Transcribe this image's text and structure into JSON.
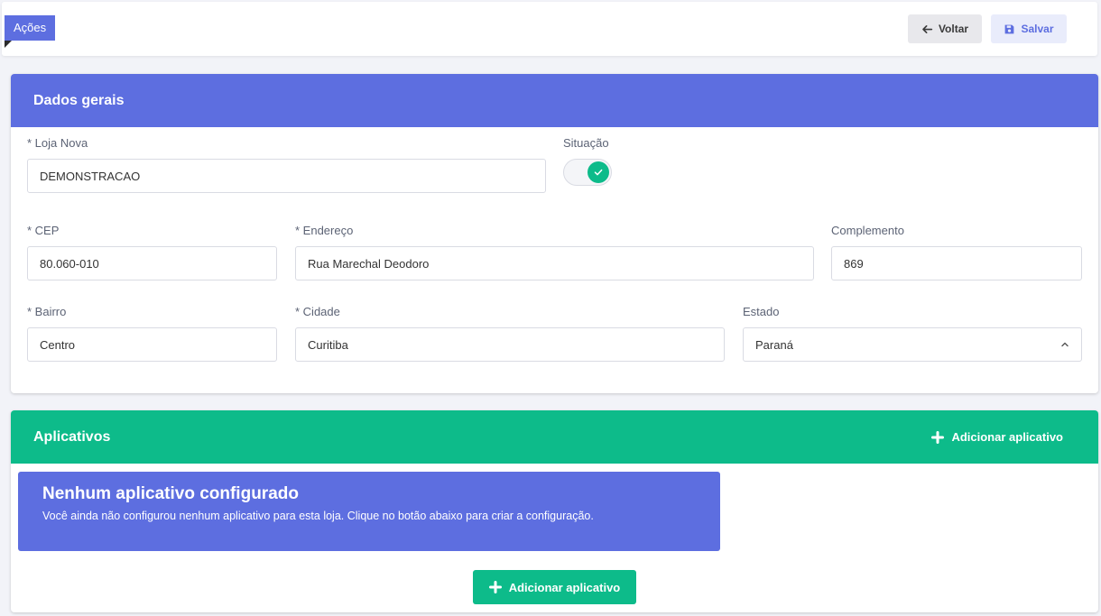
{
  "actions": {
    "ribbon_label": "Ações",
    "back_label": "Voltar",
    "save_label": "Salvar"
  },
  "general": {
    "title": "Dados gerais",
    "store": {
      "label": "* Loja Nova",
      "value": "DEMONSTRACAO"
    },
    "status": {
      "label": "Situação",
      "active": true
    },
    "cep": {
      "label": "* CEP",
      "value": "80.060-010"
    },
    "address": {
      "label": "* Endereço",
      "value": "Rua Marechal Deodoro"
    },
    "complement": {
      "label": "Complemento",
      "value": "869"
    },
    "district": {
      "label": "* Bairro",
      "value": "Centro"
    },
    "city": {
      "label": "* Cidade",
      "value": "Curitiba"
    },
    "state": {
      "label": "Estado",
      "value": "Paraná"
    }
  },
  "apps": {
    "title": "Aplicativos",
    "add_label": "Adicionar aplicativo",
    "empty_title": "Nenhum aplicativo configurado",
    "empty_text": "Você ainda não configurou nenhum aplicativo para esta loja. Clique no botão abaixo para criar a configuração.",
    "add_button_label": "Adicionar aplicativo"
  },
  "colors": {
    "primary": "#5d6ee0",
    "success": "#0dbb8a"
  }
}
